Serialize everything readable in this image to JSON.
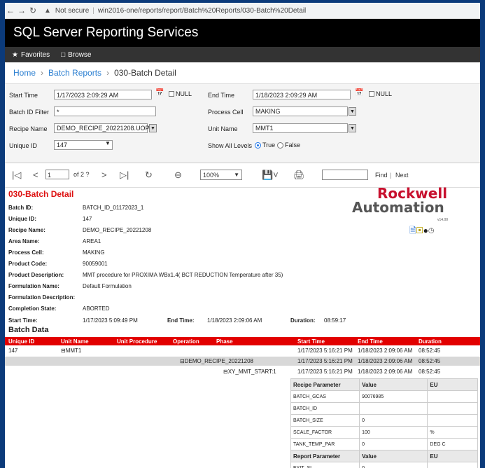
{
  "browser": {
    "warning": "Not secure",
    "url": "win2016-one/reports/report/Batch%20Reports/030-Batch%20Detail"
  },
  "app": {
    "title": "SQL Server Reporting Services",
    "nav": {
      "favorites": "Favorites",
      "browse": "Browse"
    }
  },
  "breadcrumb": {
    "home": "Home",
    "folder": "Batch Reports",
    "current": "030-Batch Detail"
  },
  "params": {
    "start_time_label": "Start Time",
    "start_time_value": "1/17/2023 2:09:29 AM",
    "null_label": "NULL",
    "end_time_label": "End Time",
    "end_time_value": "1/18/2023 2:09:29 AM",
    "batch_id_label": "Batch ID Filter",
    "batch_id_value": "*",
    "process_cell_label": "Process Cell",
    "process_cell_value": "MAKING",
    "recipe_name_label": "Recipe Name",
    "recipe_name_value": "DEMO_RECIPE_20221208.UOP",
    "unit_name_label": "Unit Name",
    "unit_name_value": "MMT1",
    "unique_id_label": "Unique ID",
    "unique_id_value": "147",
    "show_levels_label": "Show All Levels",
    "true_label": "True",
    "false_label": "False"
  },
  "toolbar": {
    "page": "1",
    "of_pages": "of 2 ?",
    "zoom": "100%",
    "find": "Find",
    "sep": "|",
    "next": "Next"
  },
  "report": {
    "title": "030-Batch Detail",
    "logo_line1": "Rockwell",
    "logo_line2": "Automation",
    "logo_version": "v14.00",
    "fields": [
      {
        "label": "Batch ID:",
        "value": "BATCH_ID_01172023_1"
      },
      {
        "label": "Unique ID:",
        "value": "147"
      },
      {
        "label": "Recipe Name:",
        "value": "DEMO_RECIPE_20221208"
      },
      {
        "label": "Area Name:",
        "value": "AREA1"
      },
      {
        "label": "Process Cell:",
        "value": "MAKING"
      },
      {
        "label": "Product Code:",
        "value": "90059001"
      },
      {
        "label": "Product Description:",
        "value": "MMT procedure for PROXIMA WBx1.4( BCT REDUCTION Temperature after 35)"
      },
      {
        "label": "Formulation Name:",
        "value": "Default Formulation"
      },
      {
        "label": "Formulation Description:",
        "value": ""
      },
      {
        "label": "Completion State:",
        "value": "ABORTED"
      }
    ],
    "start_label": "Start Time:",
    "start_value": "1/17/2023 5:09:49 PM",
    "end_label": "End Time:",
    "end_value": "1/18/2023 2:09:06 AM",
    "duration_label": "Duration:",
    "duration_value": "08:59:17",
    "section": "Batch Data",
    "columns": [
      "Unique ID",
      "Unit Name",
      "Unit Procedure",
      "Operation",
      "Phase",
      "Start Time",
      "End Time",
      "Duration"
    ],
    "rows": [
      {
        "uid": "147",
        "unit": "⊟MMT1",
        "proc": "",
        "phase": "",
        "start": "1/17/2023 5:16:21 PM",
        "end": "1/18/2023 2:09:06 AM",
        "dur": "08:52:45"
      },
      {
        "uid": "",
        "unit": "",
        "proc": "⊟DEMO_RECIPE_20221208",
        "phase": "",
        "start": "1/17/2023 5:16:21 PM",
        "end": "1/18/2023 2:09:06 AM",
        "dur": "08:52:45"
      },
      {
        "uid": "",
        "unit": "",
        "proc": "",
        "phase": "⊟XY_MMT_START:1",
        "start": "1/17/2023 5:16:21 PM",
        "end": "1/18/2023 2:09:06 AM",
        "dur": "08:52:45"
      }
    ],
    "recipe_params_header": [
      "Recipe Parameter",
      "Value",
      "EU"
    ],
    "recipe_params": [
      [
        "BATCH_GCAS",
        "90076985",
        ""
      ],
      [
        "BATCH_ID",
        "",
        ""
      ],
      [
        "BATCH_SIZE",
        "0",
        ""
      ],
      [
        "SCALE_FACTOR",
        "100",
        "%"
      ],
      [
        "TANK_TEMP_PAR",
        "0",
        "DEG C"
      ]
    ],
    "report_params_header": [
      "Report Parameter",
      "Value",
      "EU"
    ],
    "report_params": [
      [
        "EXIT_SI",
        "0",
        ""
      ]
    ]
  }
}
